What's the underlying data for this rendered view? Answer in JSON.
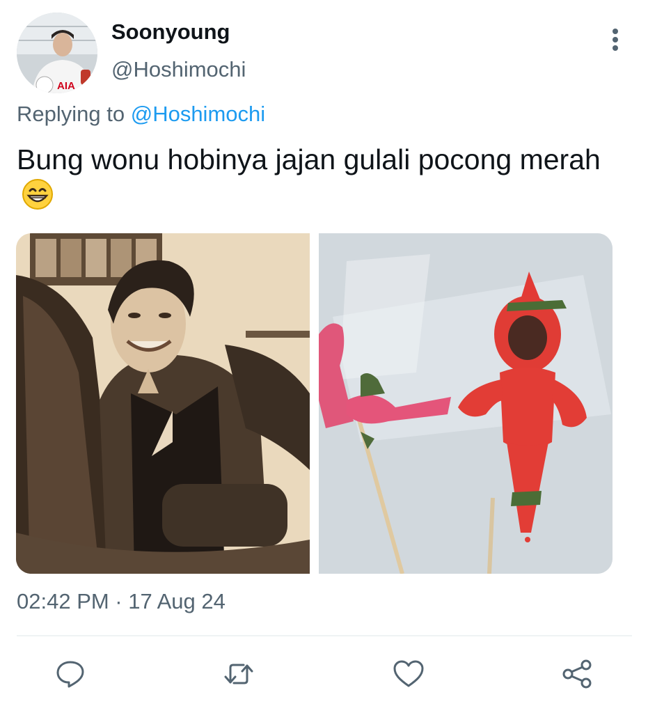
{
  "tweet": {
    "display_name": "Soonyoung",
    "handle": "@Hoshimochi",
    "reply_prefix": "Replying to",
    "reply_to": "@Hoshimochi",
    "text": "Bung wonu hobinya jajan gulali pocong merah",
    "emoji": "grinning-face-emoji",
    "timestamp": "02:42 PM · 17 Aug 24",
    "avatar_jersey_text": "AIA"
  },
  "icons": {
    "more": "more-vertical-icon",
    "reply": "reply-icon",
    "retweet": "retweet-icon",
    "like": "heart-icon",
    "share": "share-icon"
  },
  "colors": {
    "text": "#0f1419",
    "secondary": "#536471",
    "accent": "#1d9bf0",
    "divider": "#eff3f4"
  }
}
